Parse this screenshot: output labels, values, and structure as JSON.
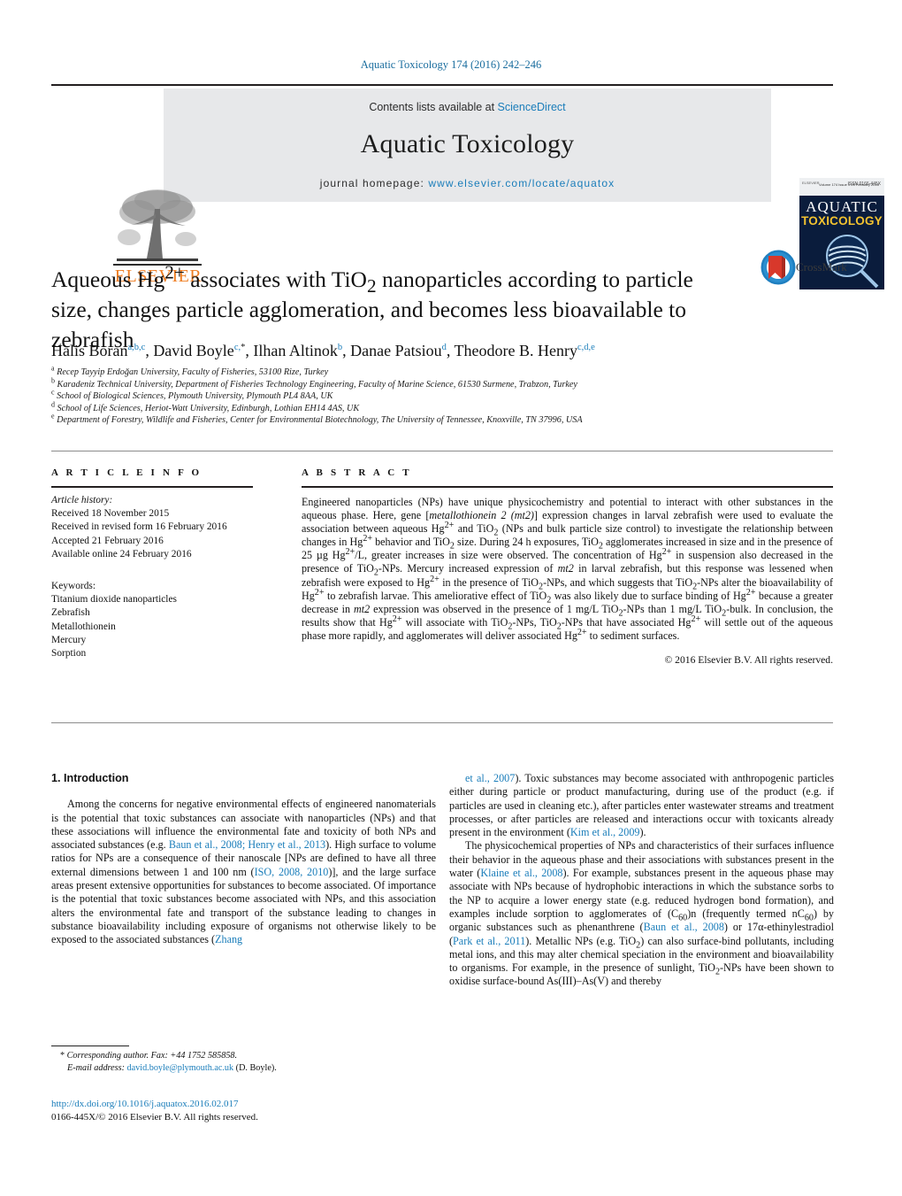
{
  "running_head": "Aquatic Toxicology 174 (2016) 242–246",
  "banner": {
    "contents_prefix": "Contents lists available at ",
    "contents_link": "ScienceDirect",
    "journal_title": "Aquatic Toxicology",
    "homepage_label": "journal homepage: ",
    "homepage_url": "www.elsevier.com/locate/aquatox",
    "publisher_wordmark": "ELSEVIER",
    "publisher_logo_icon": "elsevier-tree-icon",
    "cover": {
      "line1": "AQUATIC",
      "line2": "TOXICOLOGY",
      "top_left_logo": "ELSEVIER",
      "top_center": "Volume 174  Issue 1  25 February 2016",
      "top_right": "ISSN 0166-445X",
      "graphic_icon": "magnifying-glass-icon"
    },
    "accent_blue": "#1a7dba",
    "banner_grey": "#e7e8ea",
    "elsevier_orange": "#ef7d22",
    "cover_navy": "#0a1c3c",
    "cover_gold": "#f2c230"
  },
  "article": {
    "title_html": "Aqueous Hg<sup>2+</sup> associates with TiO<sub>2</sub> nanoparticles according to particle size, changes particle agglomeration, and becomes less bioavailable to zebrafish",
    "crossmark_label": "CrossMark",
    "crossmark_icon": "crossmark-icon",
    "authors_html": "Halis Boran<sup>a,b,c</sup>, David Boyle<sup>c,</sup><sup class=\"star\">*</sup>, Ilhan Altinok<sup>b</sup>, Danae Patsiou<sup>d</sup>, Theodore B. Henry<sup>c,d,e</sup>",
    "affiliations": [
      {
        "marker": "a",
        "text": "Recep Tayyip Erdoğan University, Faculty of Fisheries, 53100 Rize, Turkey"
      },
      {
        "marker": "b",
        "text": "Karadeniz Technical University, Department of Fisheries Technology Engineering, Faculty of Marine Science, 61530 Surmene, Trabzon, Turkey"
      },
      {
        "marker": "c",
        "text": "School of Biological Sciences, Plymouth University, Plymouth PL4 8AA, UK"
      },
      {
        "marker": "d",
        "text": "School of Life Sciences, Heriot-Watt University, Edinburgh, Lothian EH14 4AS, UK"
      },
      {
        "marker": "e",
        "text": "Department of Forestry, Wildlife and Fisheries, Center for Environmental Biotechnology, The University of Tennessee, Knoxville, TN 37996, USA"
      }
    ]
  },
  "article_info": {
    "heading": "A R T I C L E   I N F O",
    "history_label": "Article history:",
    "history": [
      "Received 18 November 2015",
      "Received in revised form 16 February 2016",
      "Accepted 21 February 2016",
      "Available online 24 February 2016"
    ],
    "keywords_label": "Keywords:",
    "keywords": [
      "Titanium dioxide nanoparticles",
      "Zebrafish",
      "Metallothionein",
      "Mercury",
      "Sorption"
    ]
  },
  "abstract": {
    "heading": "A B S T R A C T",
    "body_html": "Engineered nanoparticles (NPs) have unique physicochemistry and potential to interact with other substances in the aqueous phase. Here, gene [<i>metallothionein 2 (mt2)</i>] expression changes in larval zebrafish were used to evaluate the association between aqueous Hg<sup>2+</sup> and TiO<sub>2</sub> (NPs and bulk particle size control) to investigate the relationship between changes in Hg<sup>2+</sup> behavior and TiO<sub>2</sub> size. During 24 h exposures, TiO<sub>2</sub> agglomerates increased in size and in the presence of 25 µg Hg<sup>2+</sup>/L, greater increases in size were observed. The concentration of Hg<sup>2+</sup> in suspension also decreased in the presence of TiO<sub>2</sub>-NPs. Mercury increased expression of <i>mt2</i> in larval zebrafish, but this response was lessened when zebrafish were exposed to Hg<sup>2+</sup> in the presence of TiO<sub>2</sub>-NPs, and which suggests that TiO<sub>2</sub>-NPs alter the bioavailability of Hg<sup>2+</sup> to zebrafish larvae. This ameliorative effect of TiO<sub>2</sub> was also likely due to surface binding of Hg<sup>2+</sup> because a greater decrease in <i>mt2</i> expression was observed in the presence of 1 mg/L TiO<sub>2</sub>-NPs than 1 mg/L TiO<sub>2</sub>-bulk. In conclusion, the results show that Hg<sup>2+</sup> will associate with TiO<sub>2</sub>-NPs, TiO<sub>2</sub>-NPs that have associated Hg<sup>2+</sup> will settle out of the aqueous phase more rapidly, and agglomerates will deliver associated Hg<sup>2+</sup> to sediment surfaces.",
    "copyright": "© 2016 Elsevier B.V. All rights reserved."
  },
  "sections": {
    "intro_heading": "1.  Introduction",
    "left_paragraph_html": "Among the concerns for negative environmental effects of engineered nanomaterials is the potential that toxic substances can associate with nanoparticles (NPs) and that these associations will influence the environmental fate and toxicity of both NPs and associated substances (e.g. <span class=\"lnk\">Baun et al., 2008; Henry et al., 2013</span>). High surface to volume ratios for NPs are a consequence of their nanoscale [NPs are defined to have all three external dimensions between 1 and 100 nm (<span class=\"lnk\">ISO, 2008, 2010</span>)], and the large surface areas present extensive opportunities for substances to become associated. Of importance is the potential that toxic substances become associated with NPs, and this association alters the environmental fate and transport of the substance leading to changes in substance bioavailability including exposure of organisms not otherwise likely to be exposed to the associated substances (<span class=\"lnk\">Zhang</span>",
    "right_paragraph_1_html": "<span class=\"lnk\">et al., 2007</span>). Toxic substances may become associated with anthropogenic particles either during particle or product manufacturing, during use of the product (e.g. if particles are used in cleaning etc.), after particles enter wastewater streams and treatment processes, or after particles are released and interactions occur with toxicants already present in the environment (<span class=\"lnk\">Kim et al., 2009</span>).",
    "right_paragraph_2_html": "The physicochemical properties of NPs and characteristics of their surfaces influence their behavior in the aqueous phase and their associations with substances present in the water (<span class=\"lnk\">Klaine et al., 2008</span>). For example, substances present in the aqueous phase may associate with NPs because of hydrophobic interactions in which the substance sorbs to the NP to acquire a lower energy state (e.g. reduced hydrogen bond formation), and examples include sorption to agglomerates of (C<sub>60</sub>)n (frequently termed nC<sub>60</sub>) by organic substances such as phenanthrene (<span class=\"lnk\">Baun et al., 2008</span>) or 17α-ethinylestradiol (<span class=\"lnk\">Park et al., 2011</span>). Metallic NPs (e.g. TiO<sub>2</sub>) can also surface-bind pollutants, including metal ions, and this may alter chemical speciation in the environment and bioavailability to organisms. For example, in the presence of sunlight, TiO<sub>2</sub>-NPs have been shown to oxidise surface-bound As(III)–As(V) and thereby"
  },
  "footer": {
    "corresponding_html": "* <span class=\"it\">Corresponding author. Fax: +44 1752 585858.</span>",
    "email_html": "<span class=\"it\">E-mail address:</span> <span class=\"lnk\">david.boyle@plymouth.ac.uk</span> (D. Boyle).",
    "doi": "http://dx.doi.org/10.1016/j.aquatox.2016.02.017",
    "imprint_line": "0166-445X/© 2016 Elsevier B.V. All rights reserved."
  }
}
